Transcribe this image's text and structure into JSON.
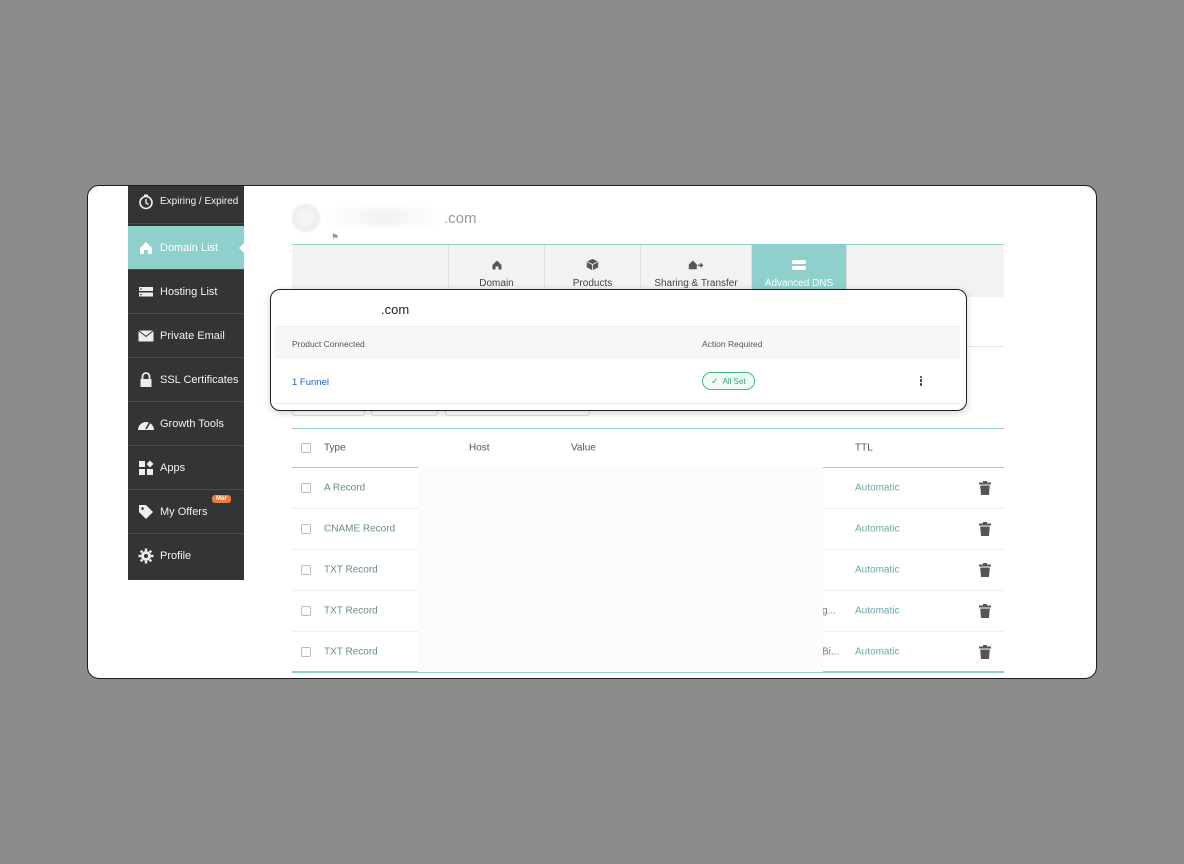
{
  "sidebar": {
    "items": [
      {
        "label": "Expiring / Expired",
        "icon": "clock-icon"
      },
      {
        "label": "Domain List",
        "icon": "home-icon",
        "active": true
      },
      {
        "label": "Hosting List",
        "icon": "server-icon"
      },
      {
        "label": "Private Email",
        "icon": "envelope-icon"
      },
      {
        "label": "SSL Certificates",
        "icon": "lock-icon"
      },
      {
        "label": "Growth Tools",
        "icon": "speedometer-icon"
      },
      {
        "label": "Apps",
        "icon": "apps-grid-icon"
      },
      {
        "label": "My Offers",
        "icon": "tag-icon",
        "badge": "Mar"
      },
      {
        "label": "Profile",
        "icon": "gear-icon"
      }
    ]
  },
  "domain": {
    "suffix": ".com"
  },
  "tabs": [
    {
      "label": "Domain",
      "icon": "home-icon"
    },
    {
      "label": "Products",
      "icon": "box-icon"
    },
    {
      "label": "Sharing & Transfer",
      "icon": "transfer-icon"
    },
    {
      "label": "Advanced DNS",
      "icon": "dns-icon",
      "active": true
    }
  ],
  "popup": {
    "domain": ".com",
    "columns": {
      "product": "Product Connected",
      "action": "Action Required"
    },
    "row": {
      "product": "1 Funnel",
      "status": "All Set"
    }
  },
  "dns": {
    "headers": {
      "type": "Type",
      "host": "Host",
      "value": "Value",
      "ttl": "TTL"
    },
    "rows": [
      {
        "type": "A Record",
        "trail": "",
        "ttl": "Automatic"
      },
      {
        "type": "CNAME Record",
        "trail": "",
        "ttl": "Automatic"
      },
      {
        "type": "TXT Record",
        "trail": "",
        "ttl": "Automatic"
      },
      {
        "type": "TXT Record",
        "trail": "g...",
        "ttl": "Automatic"
      },
      {
        "type": "TXT Record",
        "trail": "Bi...",
        "ttl": "Automatic"
      }
    ]
  },
  "colors": {
    "accent": "#8fd0cd",
    "sidebar": "#333436",
    "link": "#1d5fcf",
    "success": "#2fa86a",
    "badge": "#f07a3a"
  }
}
